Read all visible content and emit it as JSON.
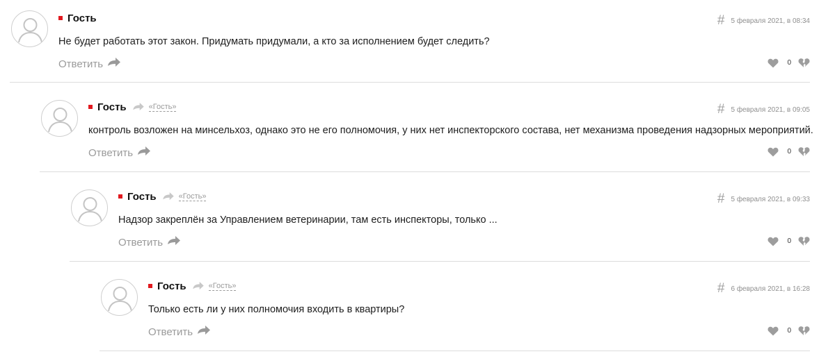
{
  "reply_label": "Ответить",
  "icons": {
    "avatar": "user-avatar-icon",
    "hash": "#",
    "reply_arrow": "arrow-right-icon",
    "like": "heart-icon",
    "dislike": "broken-heart-icon"
  },
  "colors": {
    "author_marker": "#e1191f",
    "muted": "#9a9a9a",
    "divider": "#dcdcdc"
  },
  "comments": [
    {
      "author": "Гость",
      "reply_to": "",
      "date": "5 февраля 2021, в 08:34",
      "text": "Не будет работать этот закон. Придумать придумали, а кто за исполнением будет следить?",
      "votes": "0"
    },
    {
      "author": "Гость",
      "reply_to": "«Гость»",
      "date": "5 февраля 2021, в 09:05",
      "text": "контроль возложен на минсельхоз, однако это не его полномочия, у них нет инспекторского состава, нет механизма проведения надзорных мероприятий.",
      "votes": "0"
    },
    {
      "author": "Гость",
      "reply_to": "«Гость»",
      "date": "5 февраля 2021, в 09:33",
      "text": "Надзор закреплён за Управлением ветеринарии, там есть инспекторы, только ...",
      "votes": "0"
    },
    {
      "author": "Гость",
      "reply_to": "«Гость»",
      "date": "6 февраля 2021, в 16:28",
      "text": "Только есть ли у них полномочия входить в квартиры?",
      "votes": "0"
    }
  ]
}
